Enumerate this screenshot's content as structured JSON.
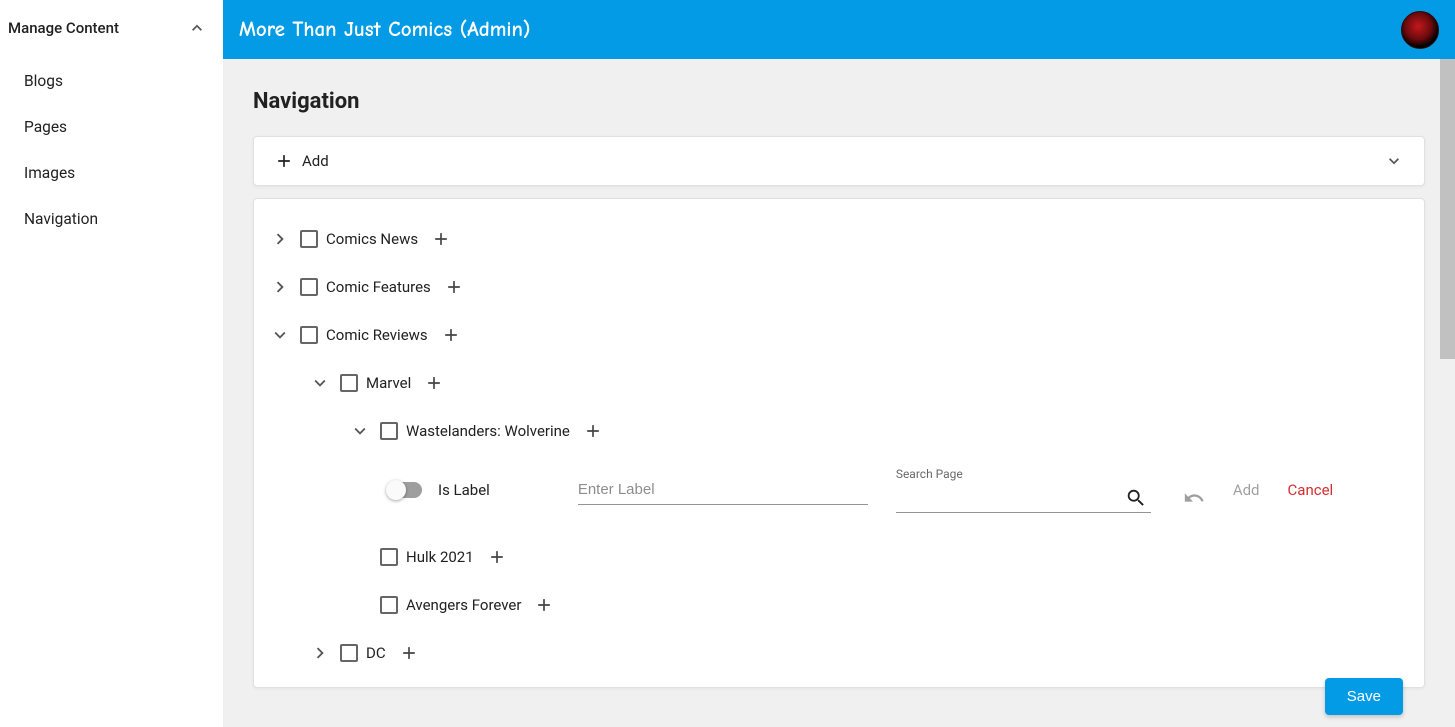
{
  "header": {
    "title": "More Than Just Comics (Admin)"
  },
  "sidebar": {
    "heading": "Manage Content",
    "items": [
      "Blogs",
      "Pages",
      "Images",
      "Navigation"
    ]
  },
  "page": {
    "title": "Navigation",
    "add_label": "Add",
    "save_label": "Save"
  },
  "tree": {
    "nodes": {
      "comics_news": "Comics News",
      "comic_features": "Comic Features",
      "comic_reviews": "Comic Reviews",
      "marvel": "Marvel",
      "wastelanders": "Wastelanders: Wolverine",
      "hulk": "Hulk 2021",
      "avengers": "Avengers Forever",
      "dc": "DC"
    }
  },
  "form": {
    "is_label_text": "Is Label",
    "enter_label_placeholder": "Enter Label",
    "search_page_label": "Search Page",
    "add_label": "Add",
    "cancel_label": "Cancel"
  }
}
